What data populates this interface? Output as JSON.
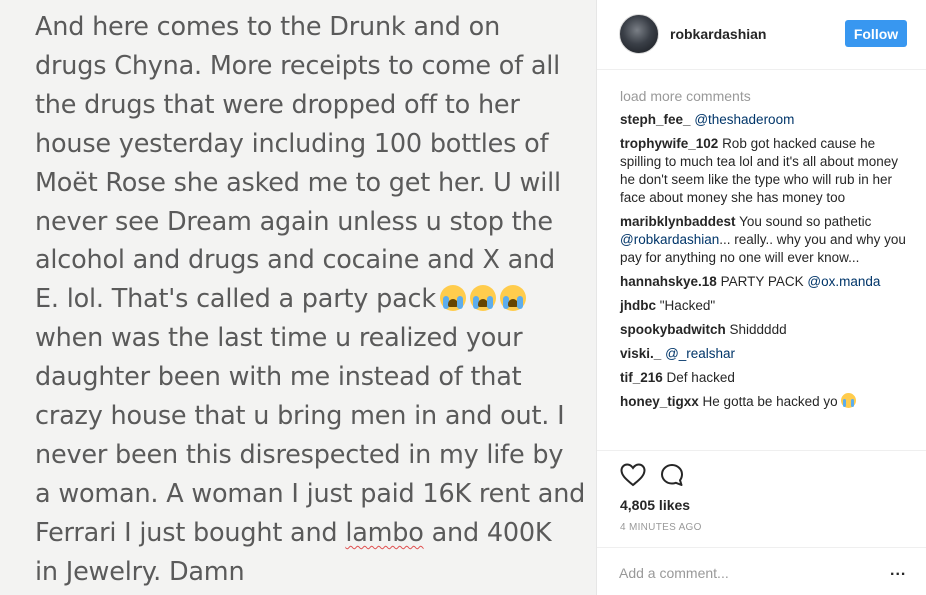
{
  "post": {
    "image_lines": [
      "And here comes to the Drunk and on",
      "drugs Chyna. More receipts to come of all",
      "the drugs that were dropped off to her",
      "house yesterday including 100 bottles of",
      "Moët Rose she asked me to get her. U will",
      "never see Dream again unless u stop the",
      "alcohol and drugs and cocaine and X and",
      "E. lol. That's called a party pack",
      "when was the last time u realized your",
      "daughter been with me instead of that",
      "crazy house that u bring men in and out. I",
      "never been this disrespected in my life by",
      "a woman. A woman I just paid 16K rent and",
      "Ferrari I just bought and",
      "lambo",
      "and 400K",
      "in Jewelry. Damn"
    ]
  },
  "header": {
    "username": "robkardashian",
    "follow_label": "Follow"
  },
  "comments": {
    "load_more": "load more comments",
    "items": [
      {
        "user": "steph_fee_",
        "text": "",
        "mention": "@theshaderoom"
      },
      {
        "user": "trophywife_102",
        "text": "Rob got hacked cause he spilling to much tea lol and it's all about money he don't seem like the type who will rub in her face about money she has money too",
        "mention": ""
      },
      {
        "user": "maribklynbaddest",
        "text": "You sound so pathetic",
        "mention": "@robkardashian",
        "text_after": "... really.. why you and why you pay for anything no one will ever know..."
      },
      {
        "user": "hannahskye.18",
        "text": "PARTY PACK",
        "mention": "@ox.manda"
      },
      {
        "user": "jhdbc",
        "text": "\"Hacked\"",
        "mention": ""
      },
      {
        "user": "spookybadwitch",
        "text": "Shiddddd",
        "mention": ""
      },
      {
        "user": "viski._",
        "text": "",
        "mention": "@_realshar"
      },
      {
        "user": "tif_216",
        "text": "Def hacked",
        "mention": ""
      },
      {
        "user": "honey_tigxx",
        "text": "He gotta be hacked yo",
        "mention": ""
      }
    ]
  },
  "footer": {
    "likes": "4,805 likes",
    "timestamp": "4 MINUTES AGO",
    "add_comment_placeholder": "Add a comment...",
    "more_label": "..."
  },
  "icons": {
    "like": "heart-icon",
    "comment": "comment-bubble-icon",
    "emoji": "loudly-crying-face-emoji"
  },
  "colors": {
    "follow_button": "#3897f0",
    "mention": "#003569",
    "muted": "#999999"
  }
}
